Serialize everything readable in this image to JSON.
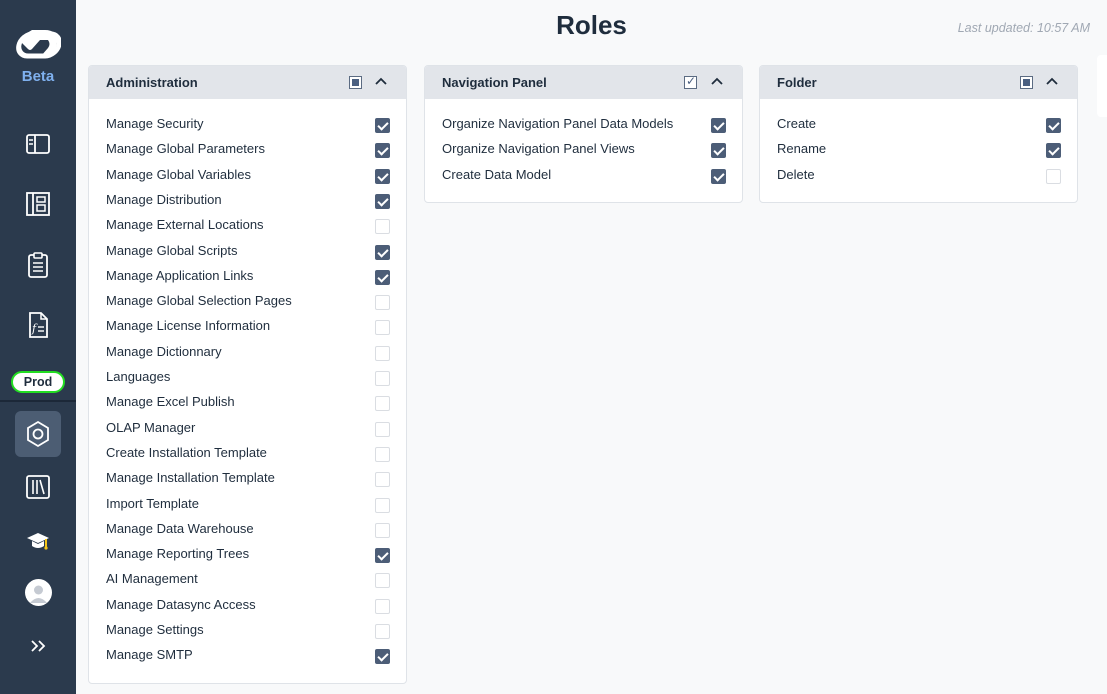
{
  "sidebar": {
    "beta_label": "Beta",
    "env_badge": "Prod",
    "icons": [
      "sidebar-panel-icon",
      "dashboard-icon",
      "clipboard-icon",
      "formula-doc-icon",
      "settings-hexagon-icon",
      "library-icon",
      "graduation-cap-icon",
      "user-avatar-icon",
      "expand-chevrons-icon"
    ],
    "colors": {
      "background": "#2b3a4d",
      "active": "#4c5d73",
      "accent": "#7fb0ee",
      "badge_border": "#22dd22"
    }
  },
  "header": {
    "title": "Roles",
    "last_updated": "Last updated: 10:57 AM"
  },
  "panels": [
    {
      "title": "Administration",
      "header_state": "partial",
      "items": [
        {
          "label": "Manage Security",
          "checked": true
        },
        {
          "label": "Manage Global Parameters",
          "checked": true
        },
        {
          "label": "Manage Global Variables",
          "checked": true
        },
        {
          "label": "Manage Distribution",
          "checked": true
        },
        {
          "label": "Manage External Locations",
          "checked": false
        },
        {
          "label": "Manage Global Scripts",
          "checked": true
        },
        {
          "label": "Manage Application Links",
          "checked": true
        },
        {
          "label": "Manage Global Selection Pages",
          "checked": false
        },
        {
          "label": "Manage License Information",
          "checked": false
        },
        {
          "label": "Manage Dictionnary",
          "checked": false
        },
        {
          "label": "Languages",
          "checked": false
        },
        {
          "label": "Manage Excel Publish",
          "checked": false
        },
        {
          "label": "OLAP Manager",
          "checked": false
        },
        {
          "label": "Create Installation Template",
          "checked": false
        },
        {
          "label": "Manage Installation Template",
          "checked": false
        },
        {
          "label": "Import Template",
          "checked": false
        },
        {
          "label": "Manage Data Warehouse",
          "checked": false
        },
        {
          "label": "Manage Reporting Trees",
          "checked": true
        },
        {
          "label": "AI Management",
          "checked": false
        },
        {
          "label": "Manage Datasync Access",
          "checked": false
        },
        {
          "label": "Manage Settings",
          "checked": false
        },
        {
          "label": "Manage SMTP",
          "checked": true
        }
      ]
    },
    {
      "title": "Navigation Panel",
      "header_state": "checked",
      "items": [
        {
          "label": "Organize Navigation Panel Data Models",
          "checked": true
        },
        {
          "label": "Organize Navigation Panel Views",
          "checked": true
        },
        {
          "label": "Create Data Model",
          "checked": true
        }
      ]
    },
    {
      "title": "Folder",
      "header_state": "partial",
      "items": [
        {
          "label": "Create",
          "checked": true
        },
        {
          "label": "Rename",
          "checked": true
        },
        {
          "label": "Delete",
          "checked": false
        }
      ]
    }
  ]
}
